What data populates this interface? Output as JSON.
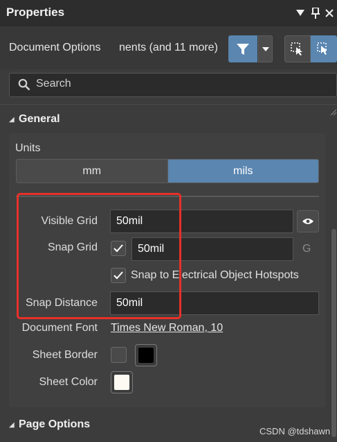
{
  "panel": {
    "title": "Properties",
    "icons": [
      "dropdown-triangle-icon",
      "pin-icon",
      "close-icon"
    ]
  },
  "toolbar": {
    "document_options": "Document Options",
    "selection_text": "nents (and 11 more)",
    "filter_icon": "filter-icon",
    "select_icons": [
      "select-inside-icon",
      "select-cursor-icon"
    ]
  },
  "search": {
    "placeholder": "Search"
  },
  "general": {
    "title": "General",
    "units_label": "Units",
    "units_options": [
      "mm",
      "mils"
    ],
    "units_selected": "mils",
    "visible_grid_label": "Visible Grid",
    "visible_grid_value": "50mil",
    "snap_grid_label": "Snap Grid",
    "snap_grid_checked": true,
    "snap_grid_value": "50mil",
    "snap_grid_hotkey": "G",
    "snap_hotspots_label": "Snap to Electrical Object Hotspots",
    "snap_hotspots_checked": true,
    "snap_distance_label": "Snap Distance",
    "snap_distance_value": "50mil",
    "document_font_label": "Document Font",
    "document_font_value": "Times New Roman, 10",
    "sheet_border_label": "Sheet Border",
    "sheet_border_checked": false,
    "sheet_border_color": "#000000",
    "sheet_color_label": "Sheet Color",
    "sheet_color": "#fdfaf3"
  },
  "page_options": {
    "title": "Page Options"
  },
  "colors": {
    "accent": "#5a86b0",
    "panel_bg": "#3c3c3c",
    "highlight": "#e8302a"
  },
  "watermark": "CSDN @tdshawn"
}
